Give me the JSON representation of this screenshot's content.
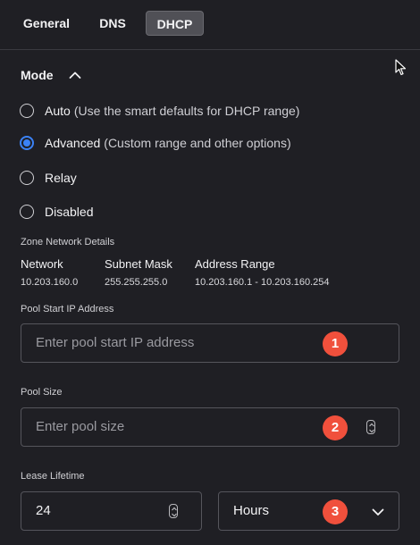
{
  "tabs": [
    {
      "label": "General",
      "active": false
    },
    {
      "label": "DNS",
      "active": false
    },
    {
      "label": "DHCP",
      "active": true
    }
  ],
  "mode": {
    "title": "Mode",
    "options": [
      {
        "label": "Auto",
        "desc": "(Use the smart defaults for DHCP range)",
        "checked": false
      },
      {
        "label": "Advanced",
        "desc": "(Custom range and other options)",
        "checked": true
      },
      {
        "label": "Relay",
        "desc": "",
        "checked": false
      },
      {
        "label": "Disabled",
        "desc": "",
        "checked": false
      }
    ]
  },
  "zone": {
    "title": "Zone Network Details",
    "columns": [
      {
        "header": "Network",
        "value": "10.203.160.0"
      },
      {
        "header": "Subnet Mask",
        "value": "255.255.255.0"
      },
      {
        "header": "Address Range",
        "value": "10.203.160.1 - 10.203.160.254"
      }
    ]
  },
  "pool_start": {
    "label": "Pool Start IP Address",
    "placeholder": "Enter pool start IP address",
    "badge": "1"
  },
  "pool_size": {
    "label": "Pool Size",
    "placeholder": "Enter pool size",
    "badge": "2"
  },
  "lease": {
    "label": "Lease Lifetime",
    "value": "24",
    "unit": "Hours",
    "badge": "3"
  },
  "colors": {
    "accent": "#3b82f6",
    "badge": "#f0503c",
    "background": "#1f1f24"
  },
  "icons": [
    "chevron-up-icon",
    "mouse-cursor-icon",
    "stepper-icon",
    "chevron-down-icon"
  ]
}
